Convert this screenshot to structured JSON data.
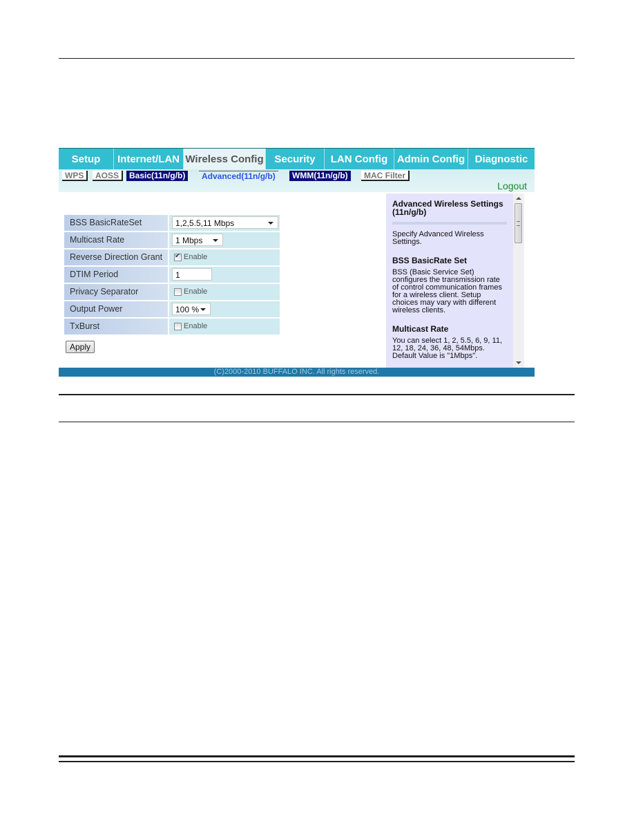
{
  "top_nav": [
    {
      "label": "Setup",
      "active": false
    },
    {
      "label": "Internet/LAN",
      "active": false
    },
    {
      "label": "Wireless Config",
      "active": true
    },
    {
      "label": "Security",
      "active": false
    },
    {
      "label": "LAN Config",
      "active": false
    },
    {
      "label": "Admin Config",
      "active": false
    },
    {
      "label": "Diagnostic",
      "active": false
    }
  ],
  "sub_nav": [
    {
      "label": "WPS"
    },
    {
      "label": "AOSS"
    },
    {
      "label": "Basic(11n/g/b)"
    },
    {
      "label": "Advanced(11n/g/b)",
      "current": true
    },
    {
      "label": "WMM(11n/g/b)"
    },
    {
      "label": "MAC Filter"
    }
  ],
  "logout_label": "Logout",
  "form": {
    "rows": [
      {
        "label": "BSS BasicRateSet",
        "type": "select",
        "value": "1,2,5.5,11 Mbps"
      },
      {
        "label": "Multicast Rate",
        "type": "select",
        "value": "1 Mbps"
      },
      {
        "label": "Reverse Direction Grant",
        "type": "checkbox",
        "checked": true,
        "option_label": "Enable"
      },
      {
        "label": "DTIM Period",
        "type": "text",
        "value": "1"
      },
      {
        "label": "Privacy Separator",
        "type": "checkbox",
        "checked": false,
        "option_label": "Enable"
      },
      {
        "label": "Output Power",
        "type": "select",
        "value": "100 %"
      },
      {
        "label": "TxBurst",
        "type": "checkbox",
        "checked": false,
        "option_label": "Enable"
      }
    ],
    "apply_label": "Apply"
  },
  "help": {
    "title": "Advanced Wireless Settings (11n/g/b)",
    "intro": "Specify Advanced Wireless Settings.",
    "sections": [
      {
        "heading": "BSS BasicRate Set",
        "text": "BSS (Basic Service Set) configures the transmission rate of control communication frames for a wireless client. Setup choices may vary with different wireless clients."
      },
      {
        "heading": "Multicast Rate",
        "text": "You can select 1, 2, 5.5, 6, 9, 11, 12, 18, 24, 36, 48, 54Mbps. Default Value is \"1Mbps\"."
      }
    ]
  },
  "footer": "(C)2000-2010 BUFFALO INC. All rights reserved."
}
